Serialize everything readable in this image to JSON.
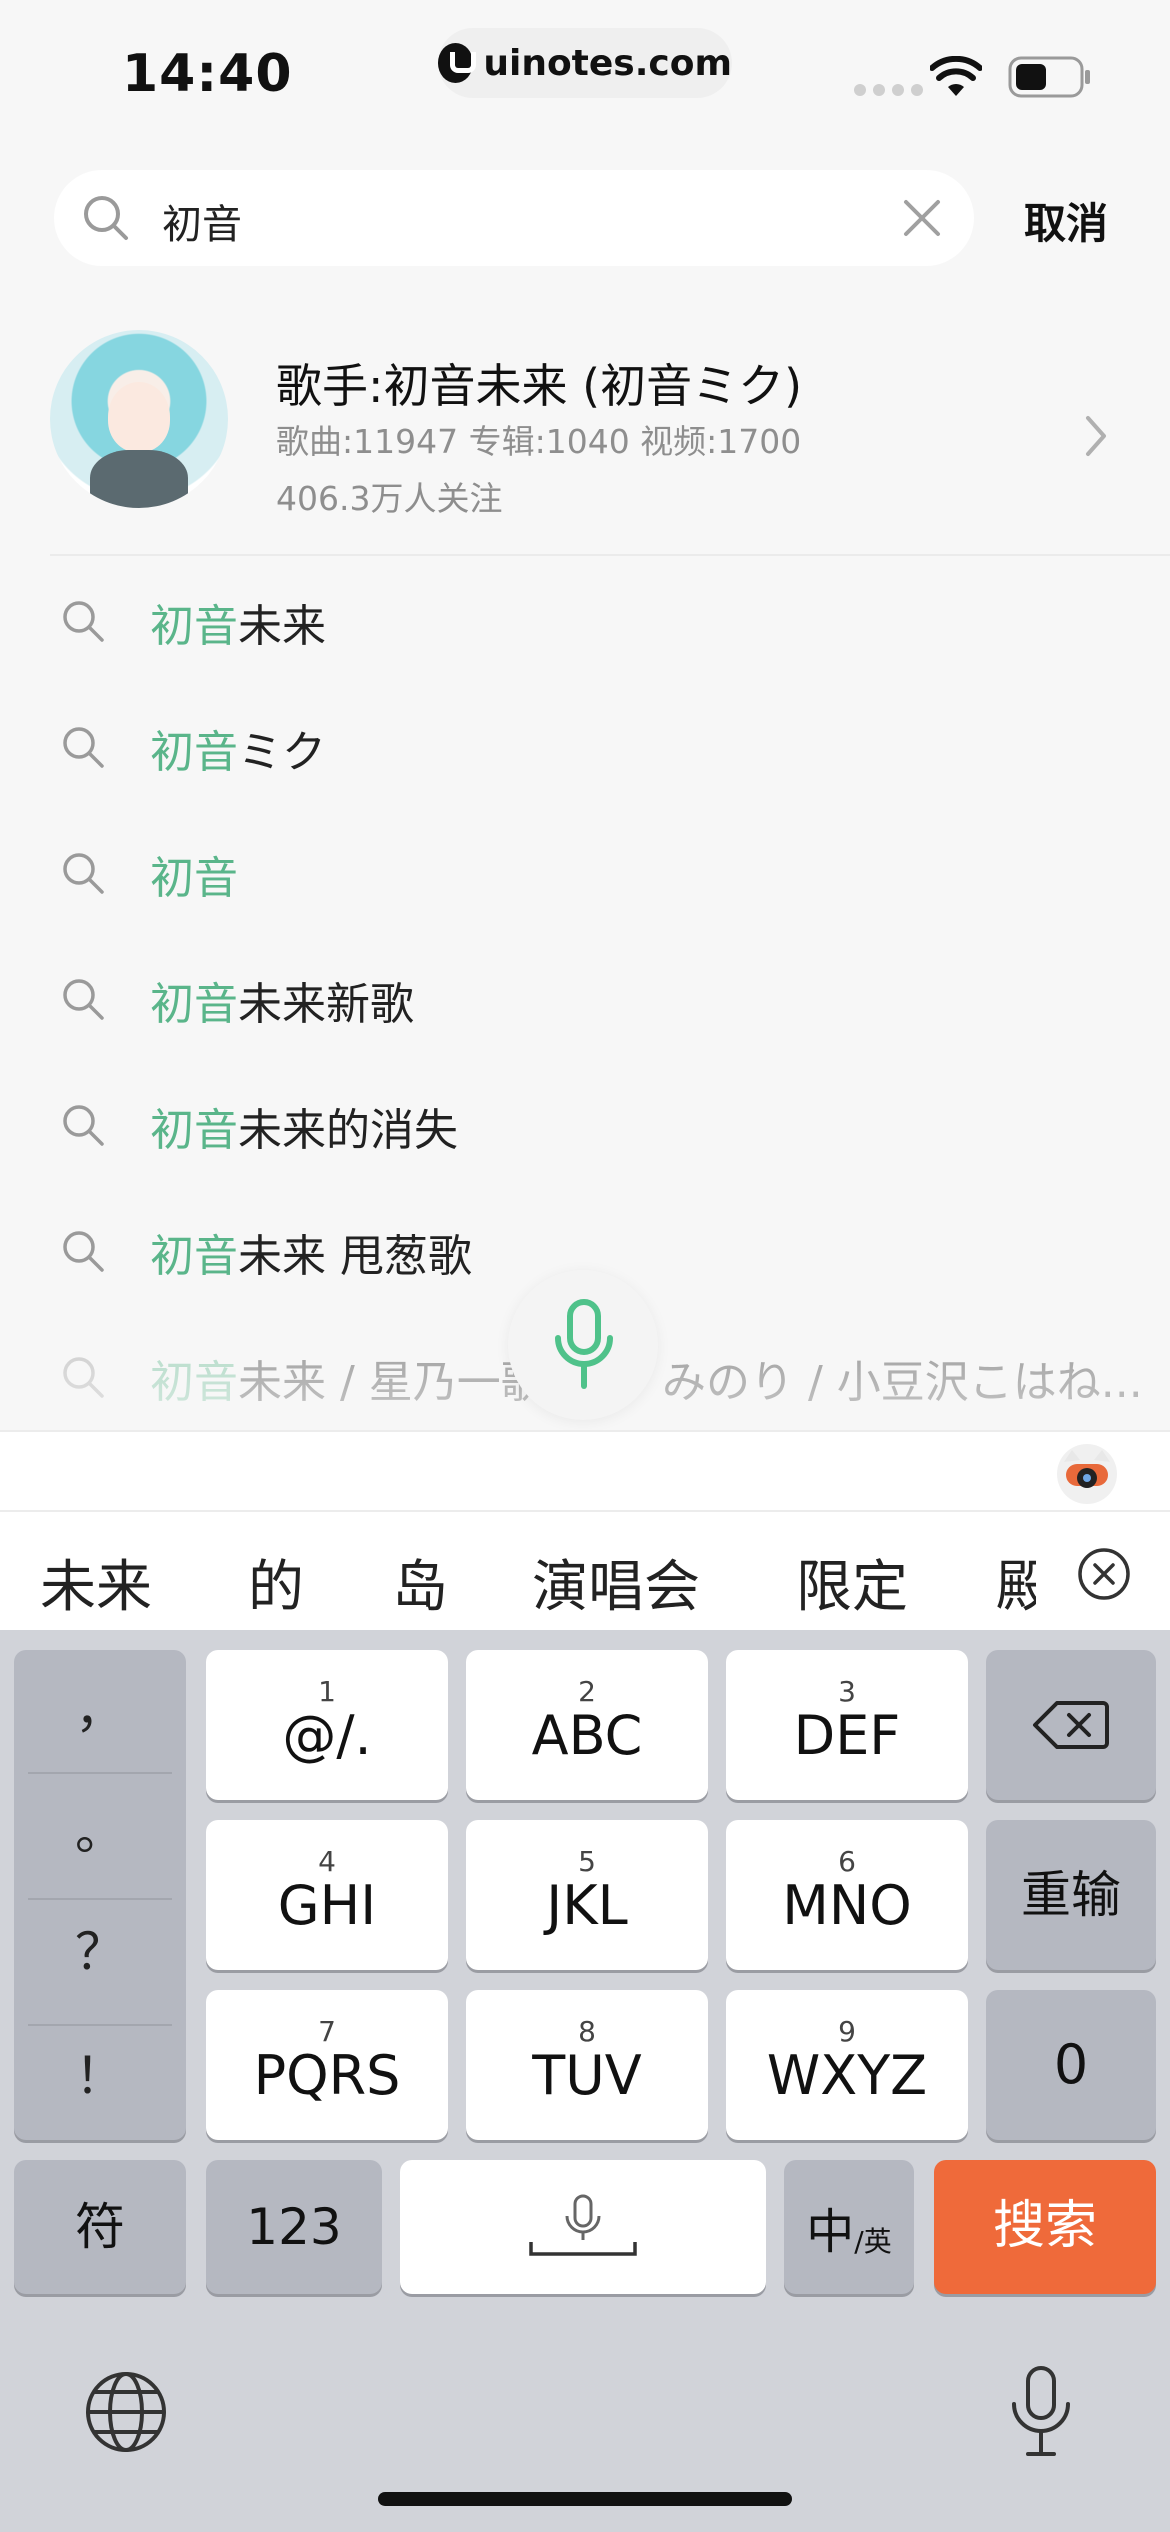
{
  "status_bar": {
    "time": "14:40",
    "url": "uinotes.com"
  },
  "search": {
    "query": "初音",
    "cancel_label": "取消"
  },
  "artist": {
    "name": "歌手:初音未来 (初音ミク)",
    "stats": "歌曲:11947 专辑:1040 视频:1700",
    "followers": "406.3万人关注"
  },
  "suggestions": [
    {
      "highlight": "初音",
      "rest": "未来"
    },
    {
      "highlight": "初音",
      "rest": "ミク"
    },
    {
      "highlight": "初音",
      "rest": ""
    },
    {
      "highlight": "初音",
      "rest": "未来新歌"
    },
    {
      "highlight": "初音",
      "rest": "未来的消失"
    },
    {
      "highlight": "初音",
      "rest": "未来 甩葱歌"
    },
    {
      "highlight": "初音",
      "rest": "未来 / 星乃一歌",
      "rest_tail": "みのり / 小豆沢こはね..."
    }
  ],
  "candidates": [
    "未来",
    "的",
    "岛",
    "演唱会",
    "限定",
    "殿"
  ],
  "keyboard": {
    "punctuation": [
      "，",
      "。",
      "？",
      "！"
    ],
    "keys": [
      {
        "num": "1",
        "label": "@/."
      },
      {
        "num": "2",
        "label": "ABC"
      },
      {
        "num": "3",
        "label": "DEF"
      },
      {
        "num": "4",
        "label": "GHI"
      },
      {
        "num": "5",
        "label": "JKL"
      },
      {
        "num": "6",
        "label": "MNO"
      },
      {
        "num": "7",
        "label": "PQRS"
      },
      {
        "num": "8",
        "label": "TUV"
      },
      {
        "num": "9",
        "label": "WXYZ"
      }
    ],
    "retype_label": "重输",
    "zero_label": "0",
    "symbol_label": "符",
    "numeric_label": "123",
    "lang_main": "中",
    "lang_sub": "/英",
    "search_label": "搜索"
  },
  "colors": {
    "highlight": "#5ab58a",
    "search_key": "#ef6a3a"
  }
}
